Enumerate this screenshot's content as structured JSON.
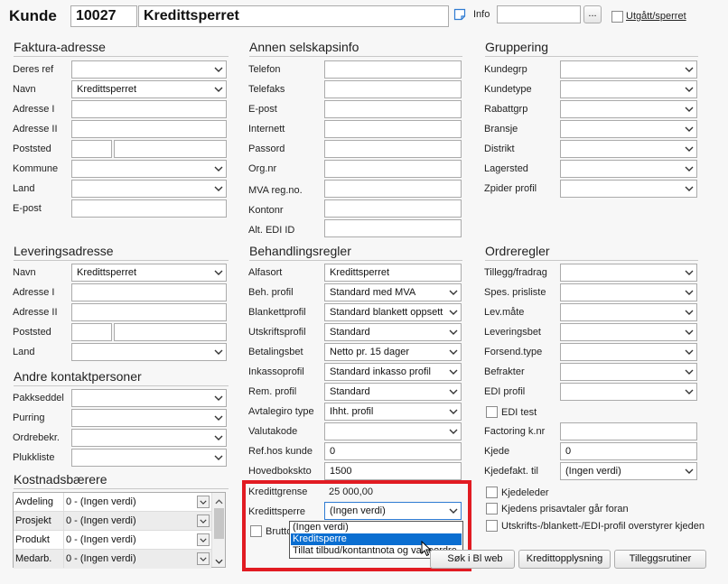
{
  "header": {
    "title": "Kunde",
    "customer_no": "10027",
    "customer_name": "Kredittsperret",
    "info_label": "Info",
    "info_value": "",
    "browse_label": "...",
    "expired_label": "Utgått/sperret"
  },
  "faktura": {
    "title": "Faktura-adresse",
    "deres_ref": {
      "label": "Deres ref",
      "value": ""
    },
    "navn": {
      "label": "Navn",
      "value": "Kredittsperret"
    },
    "adresse1": {
      "label": "Adresse I",
      "value": ""
    },
    "adresse2": {
      "label": "Adresse II",
      "value": ""
    },
    "poststed": {
      "label": "Poststed",
      "zip": "",
      "city": ""
    },
    "kommune": {
      "label": "Kommune",
      "value": ""
    },
    "land": {
      "label": "Land",
      "value": ""
    },
    "epost": {
      "label": "E-post",
      "value": ""
    }
  },
  "levering": {
    "title": "Leveringsadresse",
    "navn": {
      "label": "Navn",
      "value": "Kredittsperret"
    },
    "adresse1": {
      "label": "Adresse I",
      "value": ""
    },
    "adresse2": {
      "label": "Adresse II",
      "value": ""
    },
    "poststed": {
      "label": "Poststed",
      "zip": "",
      "city": ""
    },
    "land": {
      "label": "Land",
      "value": ""
    }
  },
  "kontakt": {
    "title": "Andre kontaktpersoner",
    "pakkseddel": {
      "label": "Pakkseddel",
      "value": ""
    },
    "purring": {
      "label": "Purring",
      "value": ""
    },
    "ordrebekr": {
      "label": "Ordrebekr.",
      "value": ""
    },
    "plukkliste": {
      "label": "Plukkliste",
      "value": ""
    }
  },
  "kostnad": {
    "title": "Kostnadsbærere",
    "rows": [
      {
        "name": "Avdeling",
        "value": "0 - (Ingen verdi)"
      },
      {
        "name": "Prosjekt",
        "value": "0 - (Ingen verdi)"
      },
      {
        "name": "Produkt",
        "value": "0 - (Ingen verdi)"
      },
      {
        "name": "Medarb.",
        "value": "0 - (Ingen verdi)"
      }
    ]
  },
  "selskap": {
    "title": "Annen selskapsinfo",
    "telefon": {
      "label": "Telefon",
      "value": ""
    },
    "telefaks": {
      "label": "Telefaks",
      "value": ""
    },
    "epost": {
      "label": "E-post",
      "value": ""
    },
    "internett": {
      "label": "Internett",
      "value": ""
    },
    "passord": {
      "label": "Passord",
      "value": ""
    },
    "orgnr": {
      "label": "Org.nr",
      "value": ""
    },
    "mva": {
      "label": "MVA reg.no.",
      "value": ""
    },
    "kontonr": {
      "label": "Kontonr",
      "value": ""
    },
    "edi": {
      "label": "Alt. EDI ID",
      "value": ""
    }
  },
  "behandling": {
    "title": "Behandlingsregler",
    "alfasort": {
      "label": "Alfasort",
      "value": "Kredittsperret"
    },
    "beh_profil": {
      "label": "Beh. profil",
      "value": "Standard med MVA"
    },
    "blankett": {
      "label": "Blankettprofil",
      "value": "Standard blankett oppsett"
    },
    "utskrift": {
      "label": "Utskriftsprofil",
      "value": "Standard"
    },
    "betaling": {
      "label": "Betalingsbet",
      "value": "Netto pr. 15 dager"
    },
    "inkasso": {
      "label": "Inkassoprofil",
      "value": "Standard inkasso profil"
    },
    "rem": {
      "label": "Rem. profil",
      "value": "Standard"
    },
    "avtalegiro": {
      "label": "Avtalegiro type",
      "value": "Ihht. profil"
    },
    "valuta": {
      "label": "Valutakode",
      "value": ""
    },
    "refhos": {
      "label": "Ref.hos kunde",
      "value": "0"
    },
    "hovedbok": {
      "label": "Hovedbokskto",
      "value": "1500"
    },
    "kredittgrense": {
      "label": "Kredittgrense",
      "value": "25 000,00"
    },
    "kredittsperre": {
      "label": "Kredittsperre",
      "value": "(Ingen verdi)",
      "options": [
        "(Ingen verdi)",
        "Kreditsperre",
        "Tillat tilbud/kontantnota og varreordre"
      ]
    },
    "brutto_label": "Brutto"
  },
  "gruppering": {
    "title": "Gruppering",
    "kundegrp": {
      "label": "Kundegrp",
      "value": ""
    },
    "kundetype": {
      "label": "Kundetype",
      "value": ""
    },
    "rabattgrp": {
      "label": "Rabattgrp",
      "value": ""
    },
    "bransje": {
      "label": "Bransje",
      "value": ""
    },
    "distrikt": {
      "label": "Distrikt",
      "value": ""
    },
    "lagersted": {
      "label": "Lagersted",
      "value": ""
    },
    "zpider": {
      "label": "Zpider profil",
      "value": ""
    }
  },
  "ordre": {
    "title": "Ordreregler",
    "tillegg": {
      "label": "Tillegg/fradrag",
      "value": ""
    },
    "spes": {
      "label": "Spes. prisliste",
      "value": ""
    },
    "levmate": {
      "label": "Lev.måte",
      "value": ""
    },
    "leveringsbet": {
      "label": "Leveringsbet",
      "value": ""
    },
    "forsend": {
      "label": "Forsend.type",
      "value": ""
    },
    "befrakter": {
      "label": "Befrakter",
      "value": ""
    },
    "ediprofil": {
      "label": "EDI profil",
      "value": ""
    },
    "editest": "EDI test",
    "factoring": {
      "label": "Factoring k.nr",
      "value": ""
    },
    "kjede": {
      "label": "Kjede",
      "value": "0"
    },
    "kjedefakt": {
      "label": "Kjedefakt. til",
      "value": "(Ingen verdi)"
    },
    "kjedeleder": "Kjedeleder",
    "kjedens": "Kjedens prisavtaler går foran",
    "utskrifts": "Utskrifts-/blankett-/EDI-profil overstyrer kjeden"
  },
  "buttons": {
    "sok": "Søk i Bl web",
    "kredittopplysning": "Kredittopplysning",
    "tillegg": "Tilleggsrutiner"
  },
  "colors": {
    "highlight": "#e11b22",
    "selection": "#0a6ed1"
  }
}
